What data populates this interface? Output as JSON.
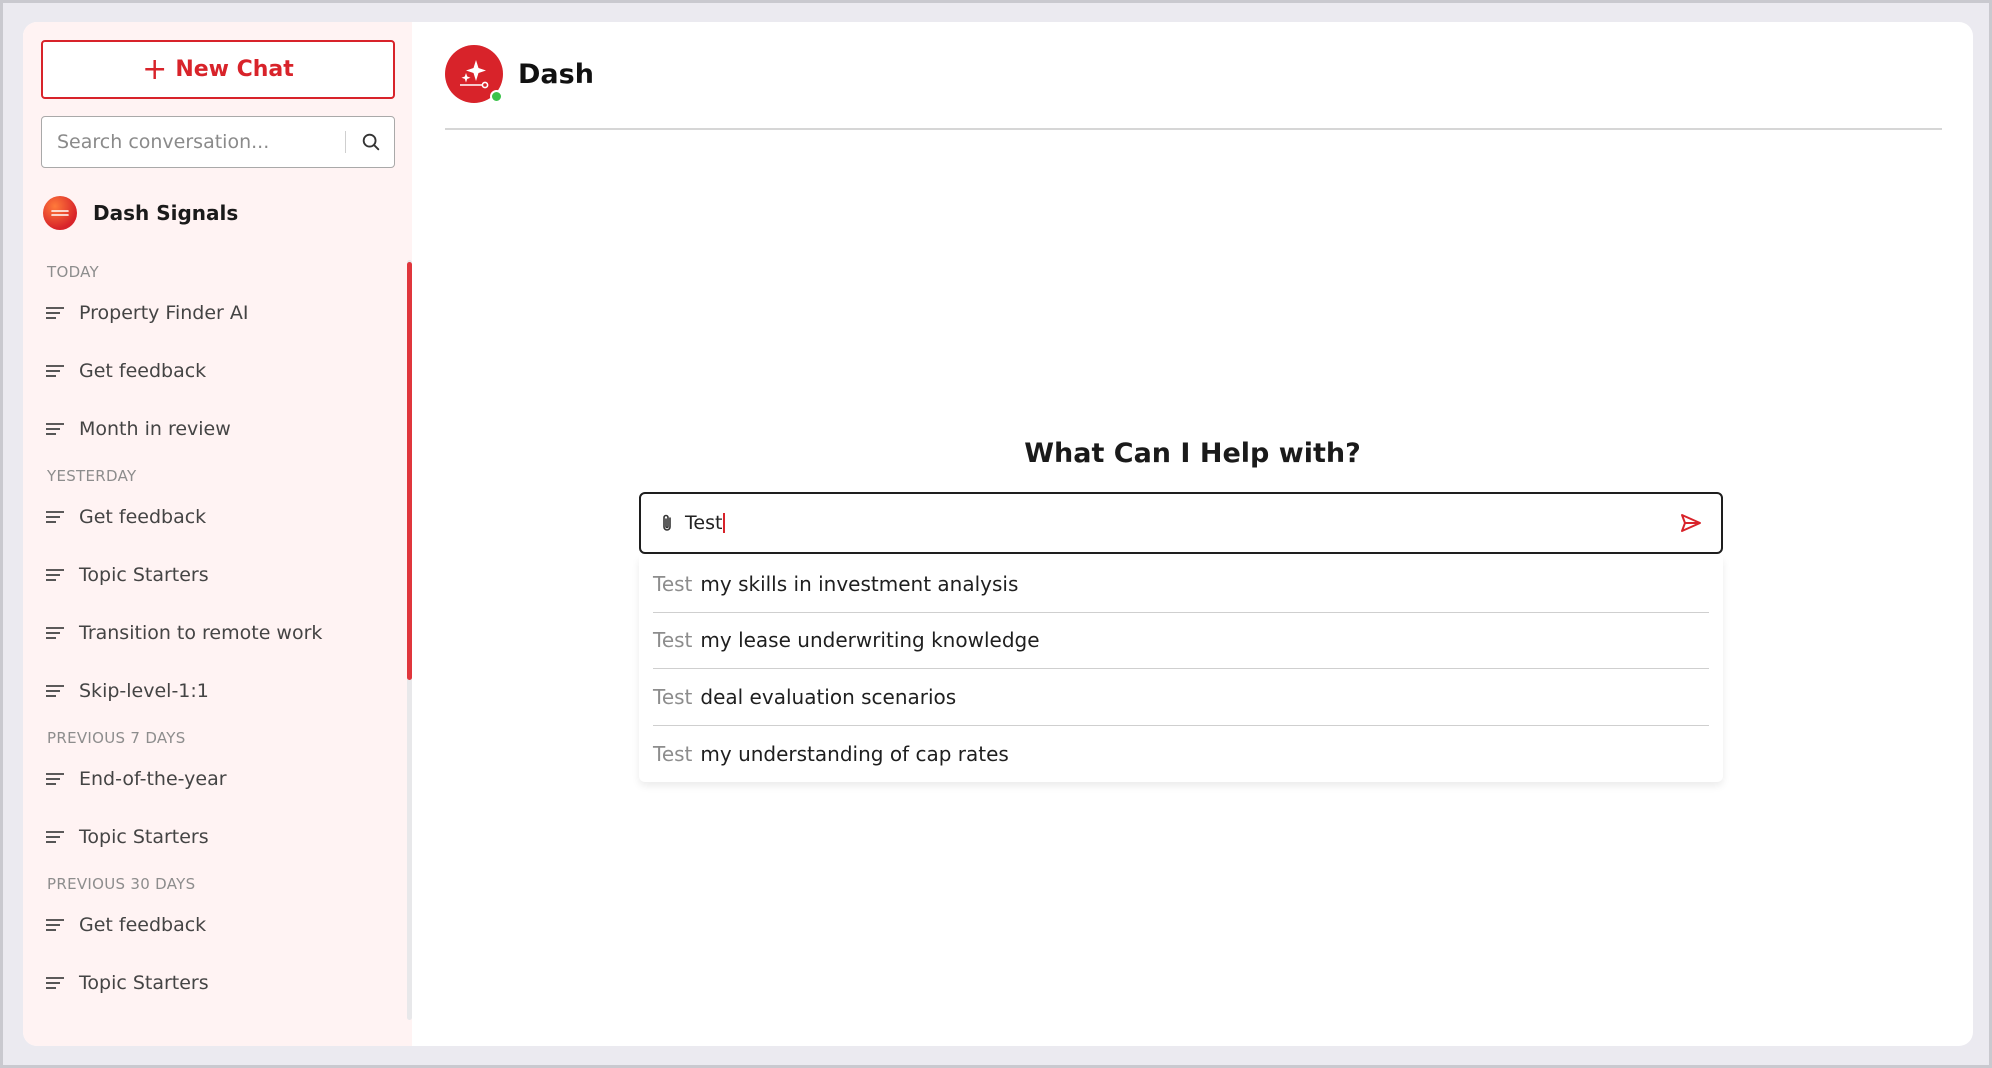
{
  "sidebar": {
    "new_chat_label": "New Chat",
    "search_placeholder": "Search conversation...",
    "signals_label": "Dash Signals",
    "sections": [
      {
        "label": "TODAY",
        "items": [
          "Property Finder AI",
          "Get feedback",
          "Month in review"
        ]
      },
      {
        "label": "YESTERDAY",
        "items": [
          "Get feedback",
          "Topic Starters",
          "Transition to remote work",
          "Skip-level-1:1"
        ]
      },
      {
        "label": "PREVIOUS 7 DAYS",
        "items": [
          "End-of-the-year",
          "Topic Starters"
        ]
      },
      {
        "label": "PREVIOUS 30 DAYS",
        "items": [
          "Get feedback",
          "Topic Starters"
        ]
      }
    ]
  },
  "header": {
    "title": "Dash",
    "status": "online"
  },
  "main": {
    "hero_title": "What Can I Help with?",
    "prompt_value": "Test",
    "suggestions": [
      {
        "prefix": "Test",
        "rest": "my skills in investment analysis"
      },
      {
        "prefix": "Test",
        "rest": "my lease underwriting knowledge"
      },
      {
        "prefix": "Test",
        "rest": "deal evaluation scenarios"
      },
      {
        "prefix": "Test",
        "rest": "my understanding of cap rates"
      }
    ]
  },
  "colors": {
    "accent": "#d8232a",
    "sidebar_bg": "#fff3f3",
    "online": "#3ac24a"
  }
}
